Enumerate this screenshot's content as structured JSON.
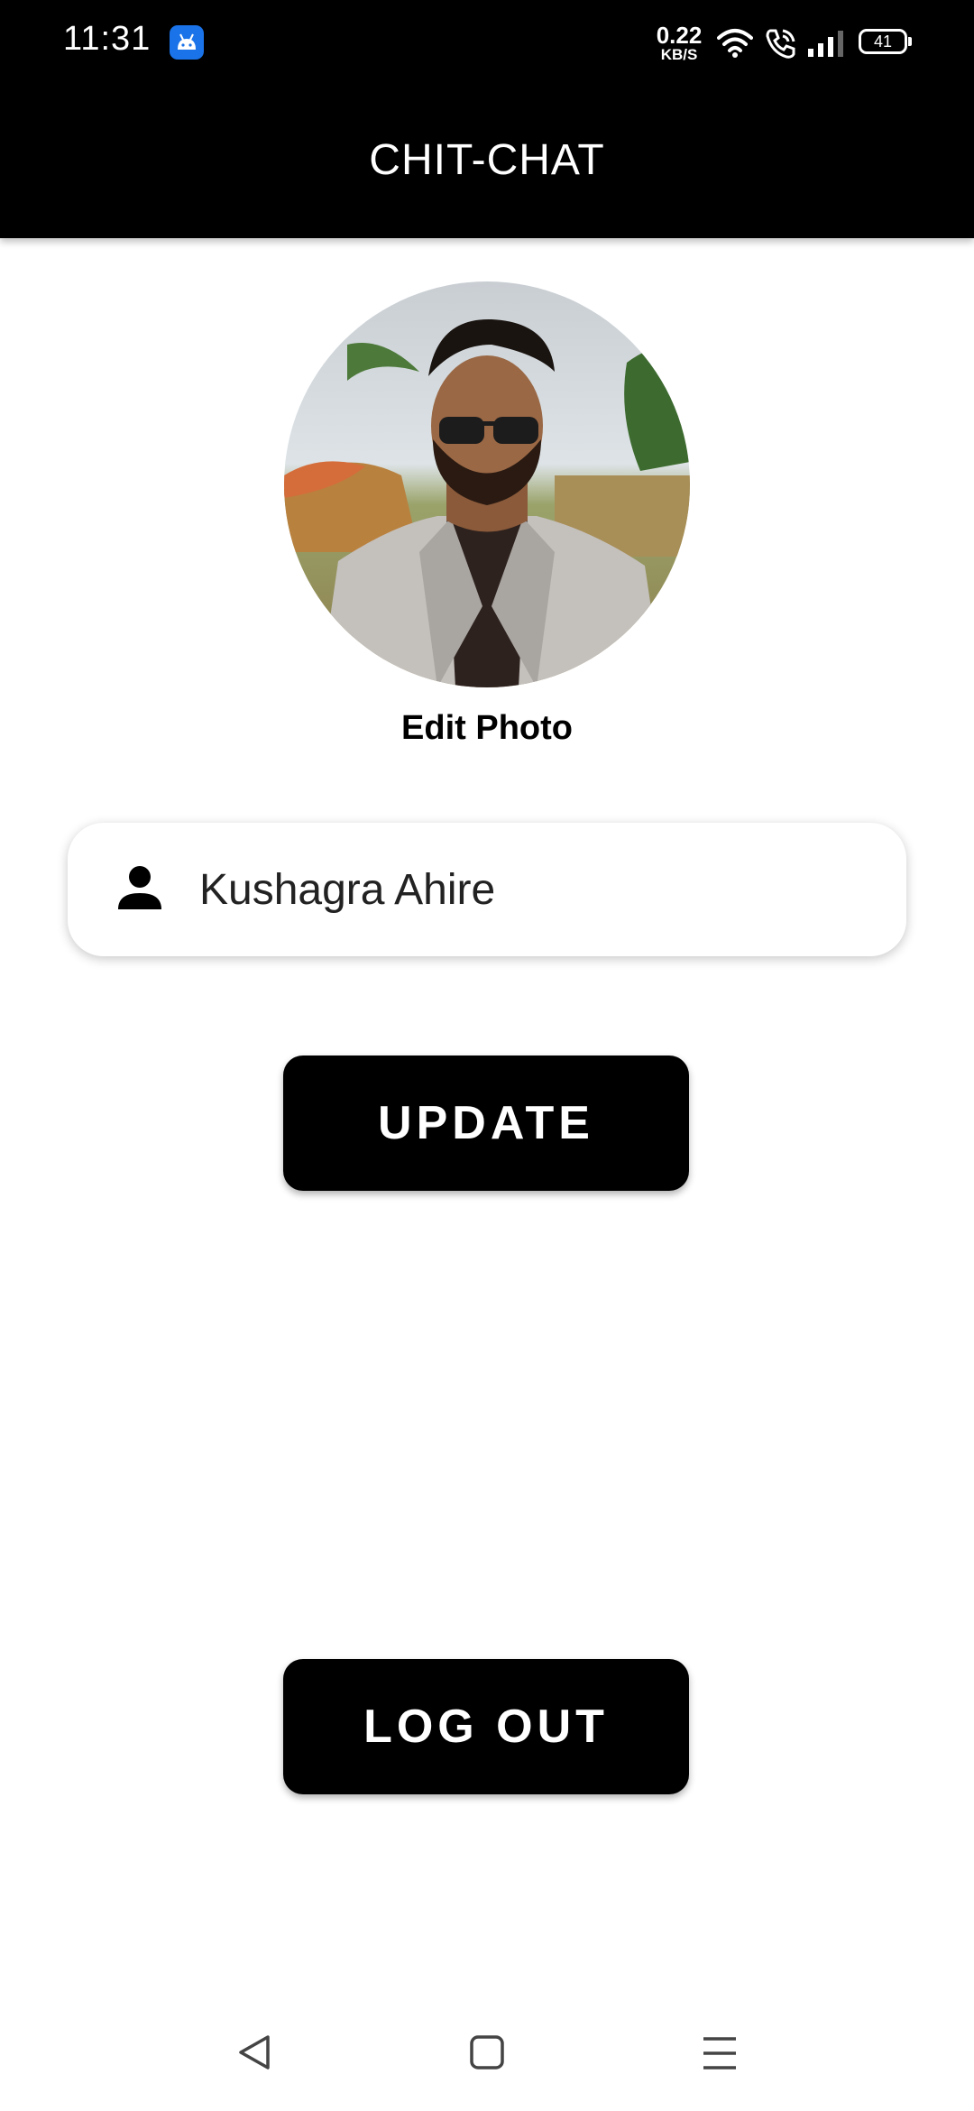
{
  "status_bar": {
    "time": "11:31",
    "net_speed_value": "0.22",
    "net_speed_unit": "KB/S",
    "battery_level": "41",
    "icons": [
      "android-icon",
      "wifi-icon",
      "wifi-calling-icon",
      "signal-icon",
      "battery-icon"
    ]
  },
  "app_bar": {
    "title": "CHIT-CHAT"
  },
  "profile": {
    "edit_photo_label": "Edit Photo",
    "name_value": "Kushagra Ahire",
    "name_icon": "person-icon"
  },
  "buttons": {
    "update_label": "UPDATE",
    "logout_label": "LOG OUT"
  },
  "nav_bar": {
    "icons": [
      "back-icon",
      "home-icon",
      "menu-icon"
    ]
  },
  "colors": {
    "bars": "#000000",
    "background": "#ffffff",
    "button": "#000000",
    "button_text": "#ffffff"
  }
}
